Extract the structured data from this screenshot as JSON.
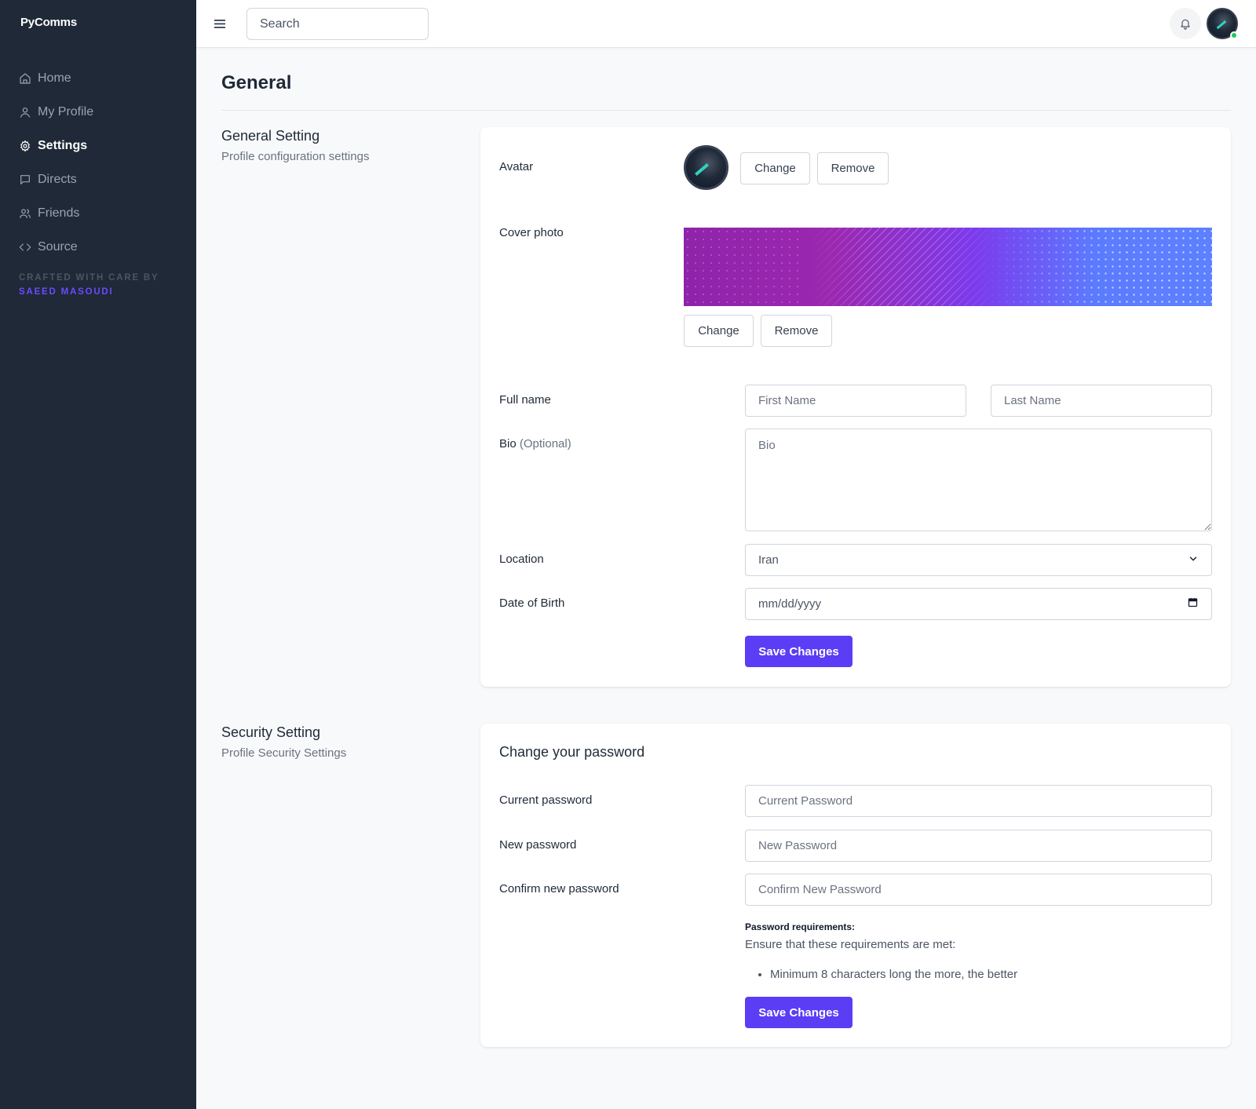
{
  "app": {
    "brand": "PyComms"
  },
  "sidebar": {
    "items": [
      {
        "label": "Home",
        "icon": "home-icon",
        "active": false
      },
      {
        "label": "My Profile",
        "icon": "user-icon",
        "active": false
      },
      {
        "label": "Settings",
        "icon": "gear-icon",
        "active": true
      },
      {
        "label": "Directs",
        "icon": "message-icon",
        "active": false
      },
      {
        "label": "Friends",
        "icon": "users-icon",
        "active": false
      },
      {
        "label": "Source",
        "icon": "code-icon",
        "active": false
      }
    ],
    "crafted_by": "CRAFTED WITH CARE BY",
    "author": "SAEED MASOUDI"
  },
  "topbar": {
    "search_placeholder": "Search"
  },
  "page": {
    "title": "General"
  },
  "general": {
    "heading": "General Setting",
    "subheading": "Profile configuration settings",
    "avatar_label": "Avatar",
    "avatar_change": "Change",
    "avatar_remove": "Remove",
    "cover_label": "Cover photo",
    "cover_change": "Change",
    "cover_remove": "Remove",
    "fullname_label": "Full name",
    "first_name_placeholder": "First Name",
    "last_name_placeholder": "Last Name",
    "bio_label": "Bio",
    "bio_optional": "(Optional)",
    "bio_placeholder": "Bio",
    "location_label": "Location",
    "location_value": "Iran",
    "dob_label": "Date of Birth",
    "dob_placeholder": "mm/dd/yyyy",
    "save": "Save Changes"
  },
  "security": {
    "heading": "Security Setting",
    "subheading": "Profile Security Settings",
    "card_title": "Change your password",
    "current_label": "Current password",
    "current_placeholder": "Current Password",
    "new_label": "New password",
    "new_placeholder": "New Password",
    "confirm_label": "Confirm new password",
    "confirm_placeholder": "Confirm New Password",
    "req_title": "Password requirements:",
    "req_sub": "Ensure that these requirements are met:",
    "req_items": [
      "Minimum 8 characters long the more, the better"
    ],
    "save": "Save Changes"
  },
  "colors": {
    "sidebar_bg": "#1f2937",
    "accent": "#5b3df5",
    "author": "#6d4aff",
    "online": "#22c55e"
  }
}
